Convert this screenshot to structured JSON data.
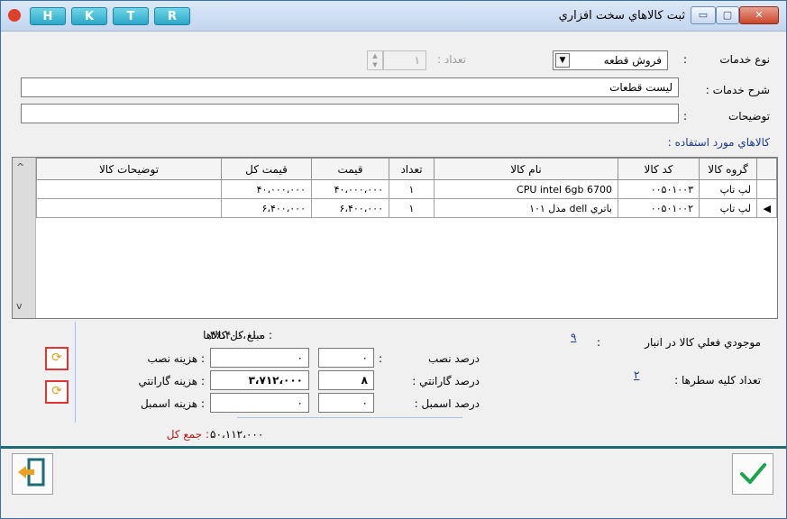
{
  "window": {
    "title": "ثبت کالاهاي سخت افزاري",
    "letter_buttons": [
      "H",
      "K",
      "T",
      "R"
    ],
    "close_label": "✕",
    "max_label": "▢",
    "min_label": "▭"
  },
  "form": {
    "service_type_label": "نوع خدمات",
    "service_type_value": "فروش قطعه",
    "count_label": "تعداد :",
    "count_value": "١",
    "service_desc_label": "شرح خدمات :",
    "service_desc_value": "ليست قطعات",
    "notes_label": "توضيحات",
    "notes_colon": ":",
    "notes_value": "",
    "colon": ":"
  },
  "goods_section_title": "کالاهاي مورد استفاده :",
  "grid": {
    "headers": [
      "گروه کالا",
      "کد کالا",
      "نام کالا",
      "تعداد",
      "قيمت",
      "قيمت کل",
      "توضيحات کالا"
    ],
    "rows": [
      [
        "لپ تاپ",
        "٠٠۵٠١٠٠٣",
        "CPU intel 6gb 6700",
        "١",
        "۴٠،٠٠٠،٠٠٠",
        "۴٠،٠٠٠،٠٠٠",
        ""
      ],
      [
        "لپ تاپ",
        "٠٠۵٠١٠٠٢",
        "باتري dell مدل ١٠١",
        "١",
        "۶،۴٠٠،٠٠٠",
        "۶،۴٠٠،٠٠٠",
        ""
      ]
    ],
    "selected_row": 1
  },
  "summary": {
    "stock_label": "موجودي فعلي کالا در انبار",
    "stock_colon": ":",
    "stock_value": "٩",
    "row_count_label": "تعداد کليه سطرها :",
    "row_count_value": "٢",
    "install_pct_label": "درصد نصب",
    "install_pct_colon": ":",
    "install_pct_value": "٠",
    "warranty_pct_label": "درصد گارانتي :",
    "warranty_pct_value": "٨",
    "assembly_pct_label": "درصد اسمبل :",
    "assembly_pct_value": "٠",
    "total_goods_label": ": مبلغ کل کالاها",
    "total_goods_value": "۴۶،۴٠٠،٠٠٠",
    "install_cost_label": ": هزينه نصب",
    "install_cost_value": "٠",
    "warranty_cost_label": ": هزينه گارانتي",
    "warranty_cost_value": "٣،٧١٢،٠٠٠",
    "assembly_cost_label": ": هزينه اسمبل",
    "assembly_cost_value": "٠",
    "grand_total_label": ": جمع کل",
    "grand_total_value": "۵٠،١١٢،٠٠٠"
  },
  "icons": {
    "refresh": "⟳",
    "exit": "⇐",
    "ok": "✔",
    "dropdown": "▼",
    "scroll_up": "^",
    "scroll_down": "v",
    "row_pointer": "◀"
  },
  "colors": {
    "accent": "#1c6b73",
    "ok_green": "#1aa34a",
    "exit_orange": "#f0a020",
    "total_red": "#b4221a"
  }
}
